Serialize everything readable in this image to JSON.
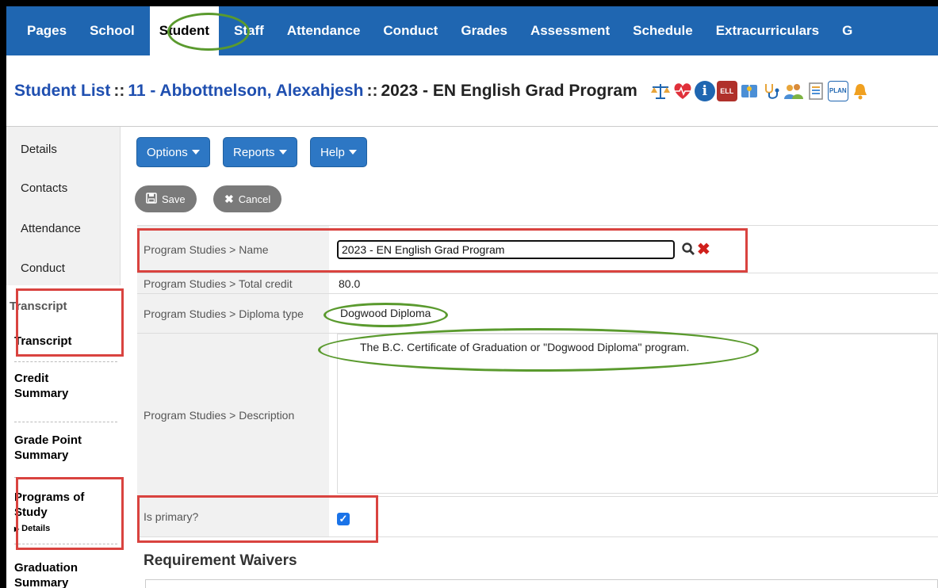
{
  "nav": {
    "tabs": [
      {
        "label": "Pages",
        "active": false
      },
      {
        "label": "School",
        "active": false
      },
      {
        "label": "Student",
        "active": true
      },
      {
        "label": "Staff",
        "active": false
      },
      {
        "label": "Attendance",
        "active": false
      },
      {
        "label": "Conduct",
        "active": false
      },
      {
        "label": "Grades",
        "active": false
      },
      {
        "label": "Assessment",
        "active": false
      },
      {
        "label": "Schedule",
        "active": false
      },
      {
        "label": "Extracurriculars",
        "active": false
      },
      {
        "label": "G",
        "active": false
      }
    ]
  },
  "header": {
    "student_list": "Student List",
    "separator": "::",
    "student": "11 - Abbottnelson, Alexahjesh",
    "program": "2023 - EN English Grad Program",
    "icons": [
      "scales-icon",
      "heart-icon",
      "info-icon",
      "ell-icon",
      "book-icon",
      "stethoscope-icon",
      "people-icon",
      "document-icon",
      "plan-icon",
      "bell-icon"
    ],
    "ell_label": "ELL",
    "plan_label": "PLAN"
  },
  "sidebar": {
    "details": "Details",
    "contacts": "Contacts",
    "attendance": "Attendance",
    "conduct": "Conduct",
    "group_transcript": "Transcript",
    "transcript": "Transcript",
    "credit_summary_1": "Credit",
    "credit_summary_2": "Summary",
    "gpa_1": "Grade Point",
    "gpa_2": "Summary",
    "programs_1": "Programs of",
    "programs_2": "Study",
    "programs_sub": "Details",
    "graduation_1": "Graduation",
    "graduation_2": "Summary"
  },
  "toolbar": {
    "options": "Options",
    "reports": "Reports",
    "help": "Help",
    "save": "Save",
    "cancel": "Cancel"
  },
  "form": {
    "name_label": "Program Studies > Name",
    "name_value": "2023 - EN English Grad Program",
    "total_credit_label": "Program Studies > Total credit",
    "total_credit_value": "80.0",
    "diploma_label": "Program Studies > Diploma type",
    "diploma_value": "Dogwood Diploma",
    "description_label": "Program Studies > Description",
    "description_value": "The B.C. Certificate of Graduation or \"Dogwood Diploma\" program.",
    "primary_label": "Is primary?",
    "primary_checked": true
  },
  "section": {
    "requirement_waivers": "Requirement Waivers"
  },
  "colors": {
    "nav_blue": "#1f66b1",
    "link_blue": "#1f4fb0",
    "highlight_red": "#d9433f",
    "highlight_green": "#5a9a2e"
  }
}
